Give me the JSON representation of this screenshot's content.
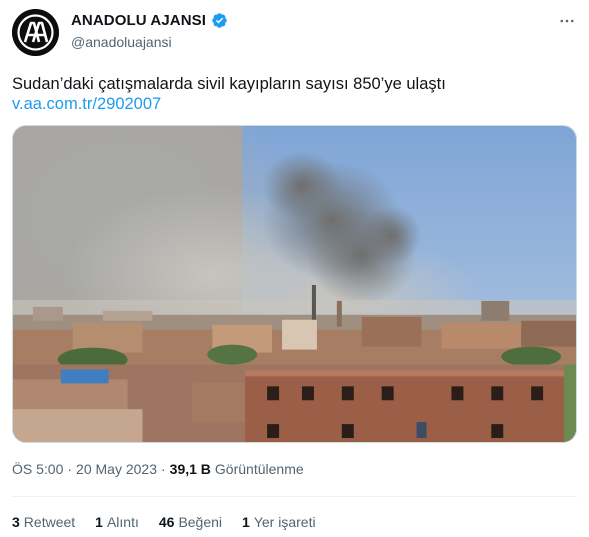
{
  "account": {
    "display_name": "ANADOLU AJANSI",
    "handle": "@anadoluajansi",
    "verified": true,
    "avatar_icon": "anadolu-agency-logo",
    "avatar_letters": "AA"
  },
  "tweet": {
    "text": "Sudan’daki çatışmalarda sivil kayıpların sayısı 850’ye ulaştı",
    "link": "v.aa.com.tr/2902007",
    "media_icon": "photo-smoke-over-city"
  },
  "meta": {
    "time": "ÖS 5:00",
    "separator": "·",
    "date": "20 May 2023",
    "views_count": "39,1 B",
    "views_label": "Görüntülenme"
  },
  "stats": [
    {
      "count": "3",
      "label": "Retweet"
    },
    {
      "count": "1",
      "label": "Alıntı"
    },
    {
      "count": "46",
      "label": "Beğeni"
    },
    {
      "count": "1",
      "label": "Yer işareti"
    }
  ],
  "colors": {
    "link": "#1d9bf0",
    "verified": "#1d9bf0",
    "text_primary": "#0f1419",
    "text_secondary": "#536471"
  }
}
